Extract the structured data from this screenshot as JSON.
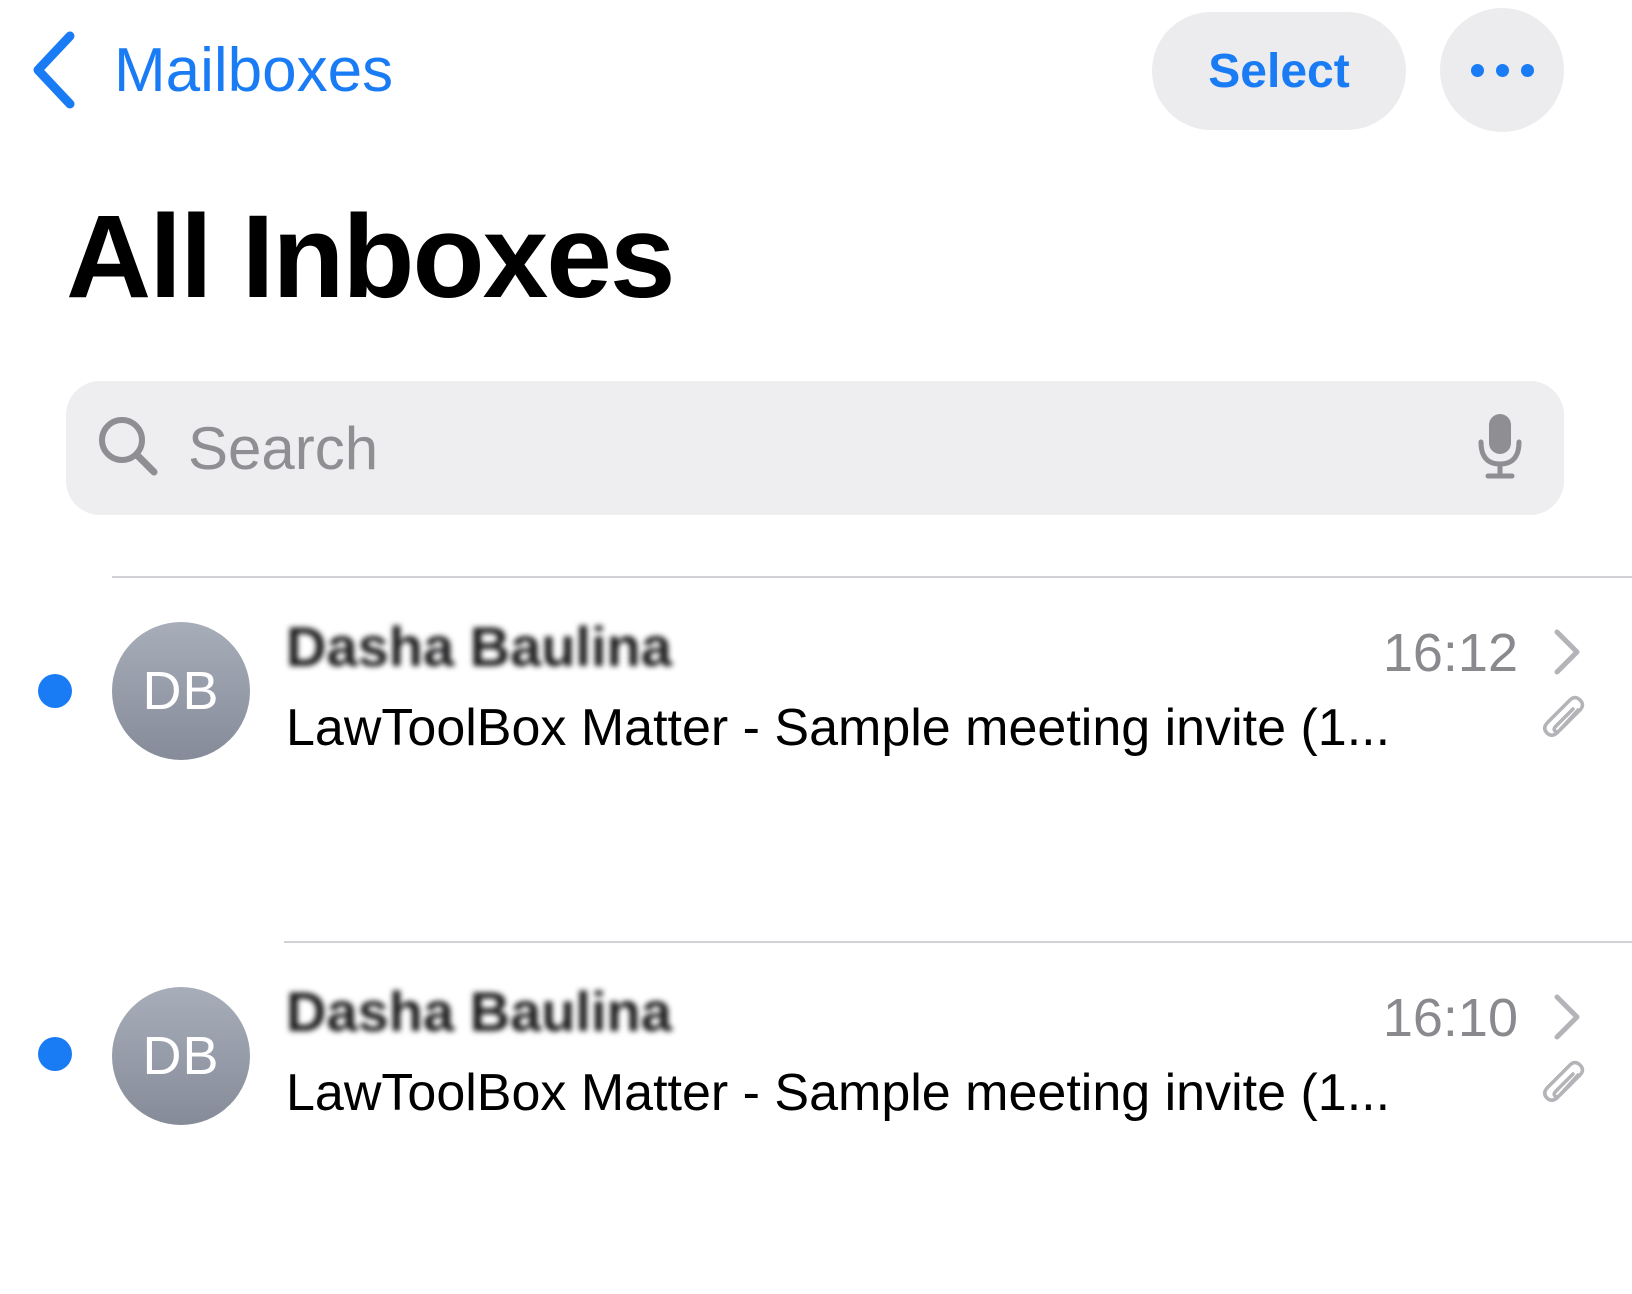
{
  "nav": {
    "back_label": "Mailboxes",
    "select_label": "Select"
  },
  "title": "All Inboxes",
  "search": {
    "placeholder": "Search"
  },
  "messages": [
    {
      "sender": "Dasha Baulina",
      "initials": "DB",
      "time": "16:12",
      "subject": "LawToolBox Matter - Sample meeting invite (1...",
      "unread": true,
      "has_attachment": true
    },
    {
      "sender": "Dasha Baulina",
      "initials": "DB",
      "time": "16:10",
      "subject": "LawToolBox Matter - Sample meeting invite (1...",
      "unread": true,
      "has_attachment": true
    }
  ],
  "colors": {
    "accent": "#1a7cf5",
    "secondary_text": "#8a8a8e",
    "control_background": "#ececee"
  },
  "icons": [
    "chevron-left-icon",
    "more-icon",
    "search-icon",
    "microphone-icon",
    "chevron-right-icon",
    "paperclip-icon"
  ]
}
